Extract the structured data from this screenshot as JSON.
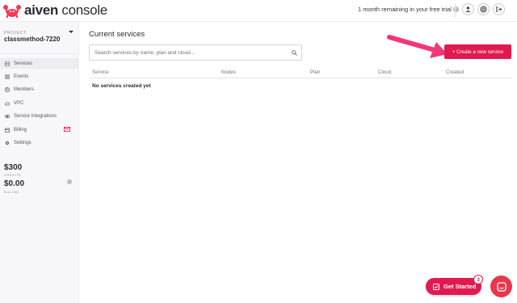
{
  "header": {
    "logo_bold": "aiven",
    "logo_light": "console",
    "trial_text": "1 month remaining in your free trial",
    "icons": [
      "user-icon",
      "help-icon",
      "logout-icon"
    ]
  },
  "sidebar": {
    "project_label": "PROJECT:",
    "project_name": "classmethod-7220",
    "items": [
      {
        "label": "Services",
        "icon": "services-icon",
        "active": true
      },
      {
        "label": "Events",
        "icon": "events-icon"
      },
      {
        "label": "Members",
        "icon": "members-icon"
      },
      {
        "label": "VPC",
        "icon": "cloud-icon"
      },
      {
        "label": "Service Integrations",
        "icon": "integrations-icon"
      },
      {
        "label": "Billing",
        "icon": "billing-icon"
      },
      {
        "label": "Settings",
        "icon": "settings-icon"
      }
    ],
    "credits_value": "$300",
    "credits_label": "CREDITS",
    "billing_value": "$0.00",
    "billing_label": "BILLING"
  },
  "main": {
    "title": "Current services",
    "search_placeholder": "Search services by name, plan and cloud...",
    "create_button": "+ Create a new service",
    "columns": [
      "Service",
      "Nodes",
      "Plan",
      "Cloud",
      "Created"
    ],
    "empty_text": "No services created yet"
  },
  "widgets": {
    "get_started": "Get Started",
    "get_started_badge": "3"
  },
  "colors": {
    "brand": "#e01a4f",
    "arrow": "#f0387a"
  }
}
